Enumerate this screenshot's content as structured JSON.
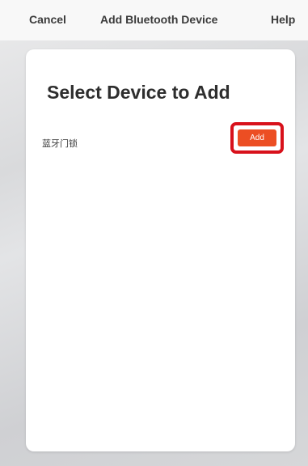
{
  "nav": {
    "cancel_label": "Cancel",
    "title": "Add Bluetooth Device",
    "help_label": "Help"
  },
  "main": {
    "heading": "Select Device to Add",
    "devices": [
      {
        "name": "蓝牙门锁",
        "action_label": "Add"
      }
    ]
  },
  "colors": {
    "accent": "#ec4e23",
    "highlight": "#d8111b",
    "card_background": "#ffffff",
    "nav_background": "#f8f8f8"
  }
}
